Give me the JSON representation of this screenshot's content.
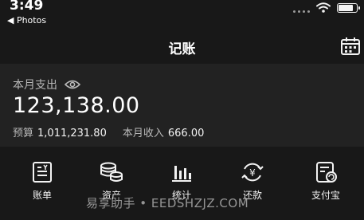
{
  "status_bar": {
    "time": "3:49",
    "back_app": "◀ Photos"
  },
  "nav": {
    "title": "记账",
    "calendar_icon": "calendar-icon"
  },
  "summary": {
    "month_expense_label": "本月支出",
    "month_expense_amount": "123,138.00",
    "budget_label": "预算",
    "budget_value": "1,011,231.80",
    "income_label": "本月收入",
    "income_value": "666.00"
  },
  "actions": [
    {
      "label": "账单",
      "icon": "bill-icon"
    },
    {
      "label": "资产",
      "icon": "coins-icon"
    },
    {
      "label": "统计",
      "icon": "chart-icon"
    },
    {
      "label": "还款",
      "icon": "repay-icon"
    },
    {
      "label": "支付宝",
      "icon": "alipay-icon"
    }
  ],
  "watermark": "易享助手 • EEDSHZJZ.COM",
  "colors": {
    "background": "#181818",
    "panel": "#222222",
    "text": "#f2f2f2",
    "muted": "#b8b8b8"
  }
}
